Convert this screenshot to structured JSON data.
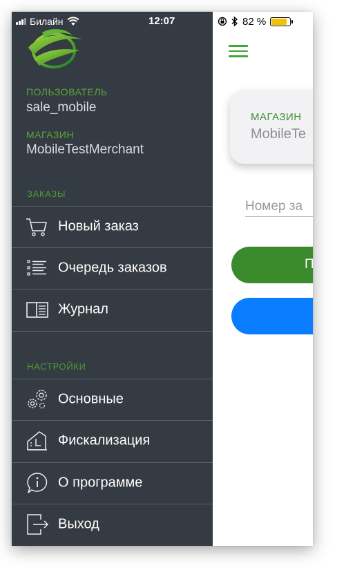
{
  "status_bar": {
    "carrier": "Билайн",
    "time": "12:07",
    "battery_percent": "82 %",
    "battery_level": 0.82,
    "battery_color": "#f2c400"
  },
  "drawer": {
    "logo": "app-logo-leaf-globe",
    "user_label": "ПОЛЬЗОВАТЕЛЬ",
    "user_value": "sale_mobile",
    "store_label": "МАГАЗИН",
    "store_value": "MobileTestMerchant",
    "sections": {
      "orders_header": "ЗАКАЗЫ",
      "settings_header": "НАСТРОЙКИ"
    },
    "items": [
      {
        "label": "Новый заказ",
        "icon": "cart-icon"
      },
      {
        "label": "Очередь заказов",
        "icon": "list-icon"
      },
      {
        "label": "Журнал",
        "icon": "journal-icon"
      },
      {
        "label": "Основные",
        "icon": "gears-icon"
      },
      {
        "label": "Фискализация",
        "icon": "register-icon"
      },
      {
        "label": "О программе",
        "icon": "info-icon"
      },
      {
        "label": "Выход",
        "icon": "exit-icon"
      }
    ]
  },
  "main": {
    "menu_icon": "hamburger-icon",
    "store_card": {
      "label": "МАГАЗИН",
      "value": "MobileTe"
    },
    "order_input_placeholder": "Номер за",
    "green_button_label": "П",
    "blue_button_label": ""
  },
  "colors": {
    "accent_green": "#3fa638",
    "drawer_background": "#353b42",
    "button_green": "#3b8a2b",
    "button_blue": "#0a7cff"
  }
}
